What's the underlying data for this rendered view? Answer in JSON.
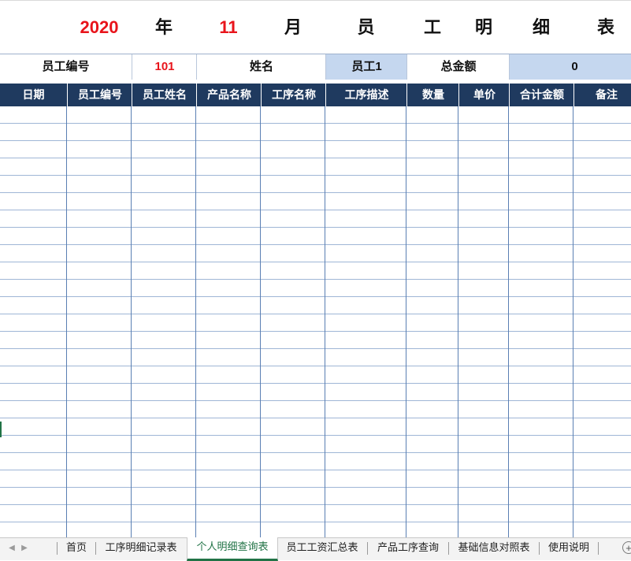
{
  "title": {
    "year": "2020",
    "year_label": "年",
    "month": "11",
    "month_label": "月",
    "heading_chars": [
      "员",
      "工",
      "明",
      "细",
      "表"
    ]
  },
  "info": {
    "employee_id_label": "员工编号",
    "employee_id_value": "101",
    "name_label": "姓名",
    "name_value": "员工1",
    "total_label": "总金额",
    "total_value": "0"
  },
  "table": {
    "headers": [
      "日期",
      "员工编号",
      "员工姓名",
      "产品名称",
      "工序名称",
      "工序描述",
      "数量",
      "单价",
      "合计金额",
      "备注"
    ]
  },
  "sheet_tabs": {
    "items": [
      "首页",
      "工序明细记录表",
      "个人明细查询表",
      "员工工资汇总表",
      "产品工序查询",
      "基础信息对照表",
      "使用说明"
    ],
    "active": "个人明细查询表"
  },
  "colors": {
    "header_bg": "#1f3a5f",
    "highlight_bg": "#c5d7ef",
    "accent_red": "#e8141b",
    "active_tab": "#217346"
  }
}
